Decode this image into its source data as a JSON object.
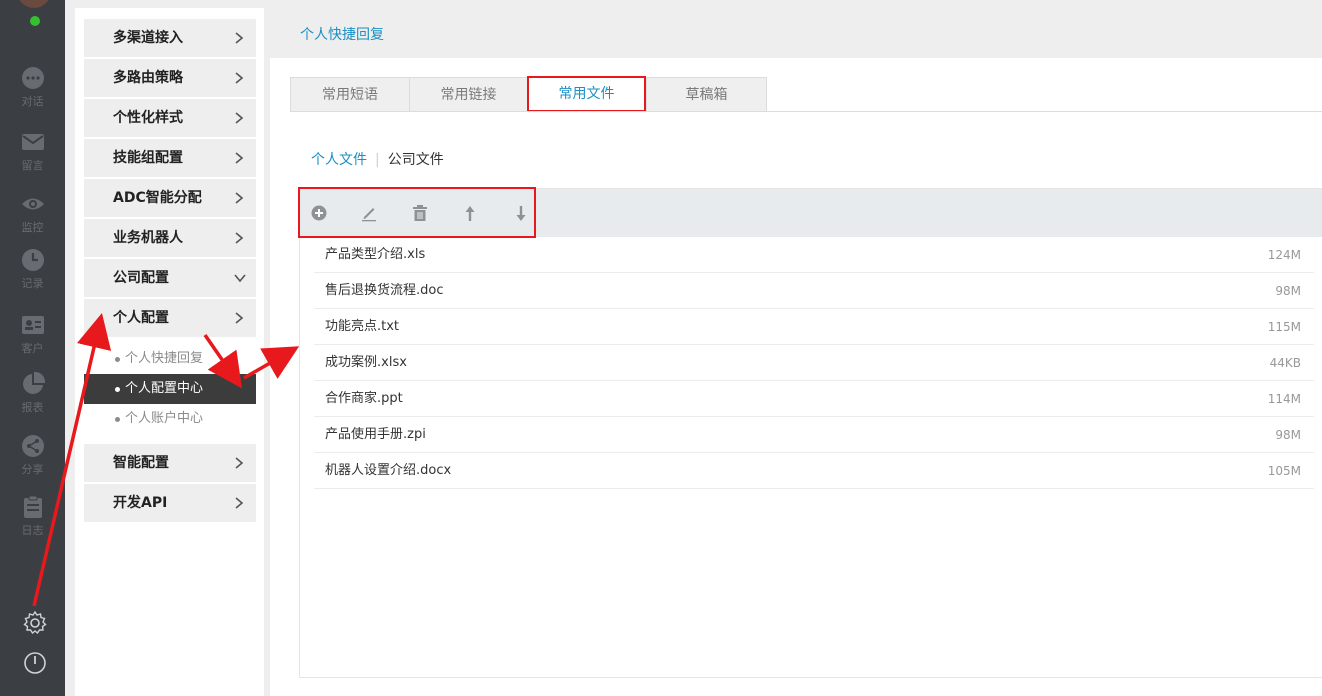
{
  "rail": {
    "items": [
      {
        "label": "对话",
        "icon": "chat-icon"
      },
      {
        "label": "留言",
        "icon": "mail-icon"
      },
      {
        "label": "监控",
        "icon": "eye-icon"
      },
      {
        "label": "记录",
        "icon": "clock-icon"
      },
      {
        "label": "客户",
        "icon": "contact-card-icon"
      },
      {
        "label": "报表",
        "icon": "pie-chart-icon"
      },
      {
        "label": "分享",
        "icon": "share-icon"
      },
      {
        "label": "日志",
        "icon": "clipboard-icon"
      }
    ],
    "bottom": [
      {
        "icon": "gear-icon"
      },
      {
        "icon": "power-icon"
      }
    ]
  },
  "sidebar": {
    "items": [
      {
        "label": "多渠道接入",
        "chevron": "right"
      },
      {
        "label": "多路由策略",
        "chevron": "right"
      },
      {
        "label": "个性化样式",
        "chevron": "right"
      },
      {
        "label": "技能组配置",
        "chevron": "right"
      },
      {
        "label": "ADC智能分配",
        "chevron": "right"
      },
      {
        "label": "业务机器人",
        "chevron": "right"
      },
      {
        "label": "公司配置",
        "chevron": "down"
      },
      {
        "label": "个人配置",
        "chevron": "right"
      }
    ],
    "sub_items": [
      {
        "label": "个人快捷回复",
        "active": false
      },
      {
        "label": "个人配置中心",
        "active": true
      },
      {
        "label": "个人账户中心",
        "active": false
      }
    ],
    "items_after": [
      {
        "label": "智能配置",
        "chevron": "right"
      },
      {
        "label": "开发API",
        "chevron": "right"
      }
    ]
  },
  "header": {
    "title": "个人快捷回复"
  },
  "tabs": [
    {
      "label": "常用短语",
      "active": false
    },
    {
      "label": "常用链接",
      "active": false
    },
    {
      "label": "常用文件",
      "active": true
    },
    {
      "label": "草稿箱",
      "active": false
    }
  ],
  "breadcrumb": {
    "personal": "个人文件",
    "separator": "|",
    "company": "公司文件"
  },
  "toolbar": {
    "icons": [
      "add-circle-icon",
      "edit-icon",
      "trash-icon",
      "arrow-up-icon",
      "arrow-down-icon"
    ]
  },
  "files": [
    {
      "name": "产品类型介绍.xls",
      "size": "124M"
    },
    {
      "name": "售后退换货流程.doc",
      "size": "98M"
    },
    {
      "name": "功能亮点.txt",
      "size": "115M"
    },
    {
      "name": "成功案例.xlsx",
      "size": "44KB"
    },
    {
      "name": "合作商家.ppt",
      "size": "114M"
    },
    {
      "name": "产品使用手册.zpi",
      "size": "98M"
    },
    {
      "name": "机器人设置介绍.docx",
      "size": "105M"
    }
  ],
  "colors": {
    "accent": "#1a8fc4",
    "highlight": "#e8191c",
    "rail": "#3b3e42",
    "active_sub": "#3c3c3c"
  }
}
